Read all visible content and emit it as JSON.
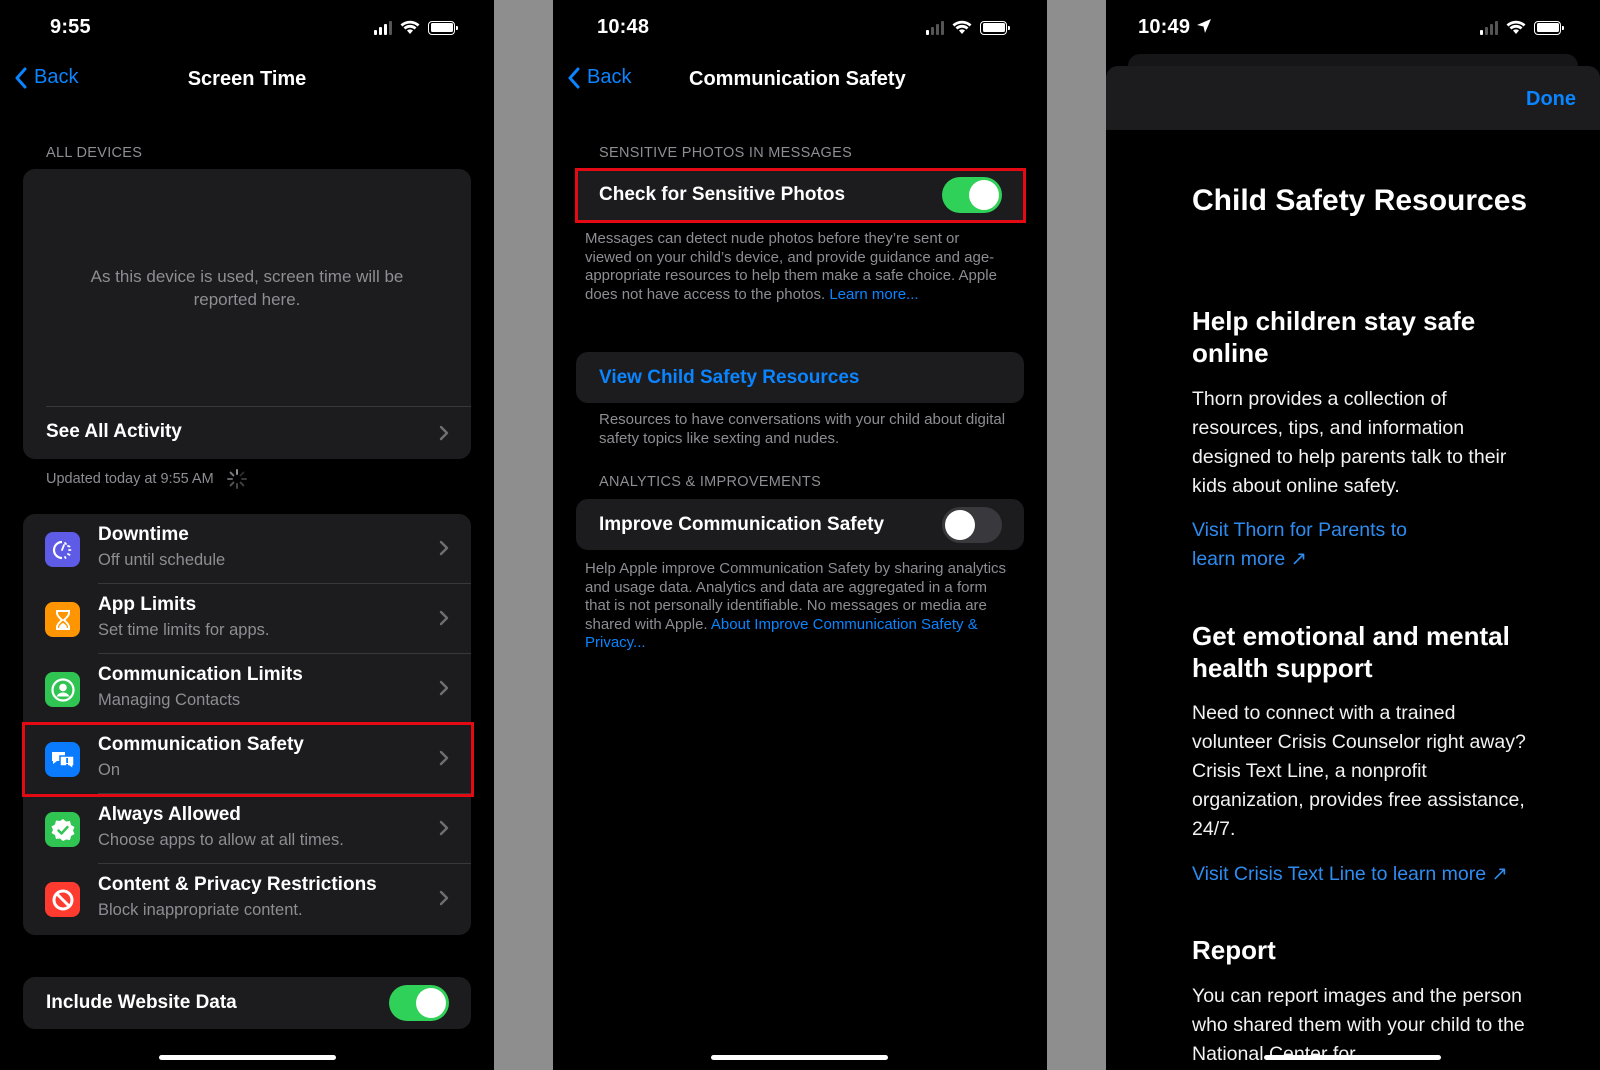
{
  "colors": {
    "accent": "#0a84ff",
    "toggle_on": "#30d158",
    "highlight": "#e50914",
    "cell_bg": "#1c1c1e"
  },
  "screen1": {
    "status": {
      "time": "9:55"
    },
    "nav": {
      "back_label": "Back",
      "title": "Screen Time"
    },
    "all_devices_header": "ALL DEVICES",
    "chart_placeholder": "As this device is used, screen time will be reported here.",
    "see_all_activity": "See All Activity",
    "updated_text": "Updated today at 9:55 AM",
    "items": [
      {
        "icon": "downtime-icon",
        "color": "#5e5ce6",
        "title": "Downtime",
        "subtitle": "Off until schedule"
      },
      {
        "icon": "hourglass-icon",
        "color": "#ff9500",
        "title": "App Limits",
        "subtitle": "Set time limits for apps."
      },
      {
        "icon": "contact-icon",
        "color": "#30c452",
        "title": "Communication Limits",
        "subtitle": "Managing Contacts"
      },
      {
        "icon": "chat-bubbles-icon",
        "color": "#0a7aff",
        "title": "Communication Safety",
        "subtitle": "On",
        "highlighted": true
      },
      {
        "icon": "checkmark-badge-icon",
        "color": "#30c452",
        "title": "Always Allowed",
        "subtitle": "Choose apps to allow at all times."
      },
      {
        "icon": "restricted-icon",
        "color": "#ff3b30",
        "title": "Content & Privacy Restrictions",
        "subtitle": "Block inappropriate content."
      }
    ],
    "include_website_data": {
      "label": "Include Website Data",
      "on": true
    }
  },
  "screen2": {
    "status": {
      "time": "10:48"
    },
    "nav": {
      "back_label": "Back",
      "title": "Communication Safety"
    },
    "sensitive_header": "SENSITIVE PHOTOS IN MESSAGES",
    "check_sensitive": {
      "label": "Check for Sensitive Photos",
      "on": true
    },
    "sensitive_footer": "Messages can detect nude photos before they’re sent or viewed on your child’s device, and provide guidance and age-appropriate resources to help them make a safe choice. Apple does not have access to the photos. ",
    "sensitive_footer_link": "Learn more...",
    "view_resources_label": "View Child Safety Resources",
    "resources_footer": "Resources to have conversations with your child about digital safety topics like sexting and nudes.",
    "analytics_header": "ANALYTICS & IMPROVEMENTS",
    "improve": {
      "label": "Improve Communication Safety",
      "on": false
    },
    "improve_footer": "Help Apple improve Communication Safety by sharing analytics and usage data. Analytics and data are aggregated in a form that is not personally identifiable. No messages or media are shared with Apple. ",
    "improve_footer_link": "About Improve Communication Safety & Privacy..."
  },
  "screen3": {
    "status": {
      "time": "10:49"
    },
    "done_label": "Done",
    "title": "Child Safety Resources",
    "sections": [
      {
        "heading": "Help children stay safe online",
        "body": "Thorn provides a collection of resources, tips, and information designed to help parents talk to their kids about online safety.",
        "link": "Visit Thorn for Parents to learn more ↗"
      },
      {
        "heading": "Get emotional and mental health support",
        "body": "Need to connect with a trained volunteer Crisis Counselor right away? Crisis Text Line, a nonprofit organization, provides free assistance, 24/7.",
        "link": "Visit Crisis Text Line to learn more ↗"
      },
      {
        "heading": "Report",
        "body": "You can report images and the person who shared them with your child to the National Center for"
      }
    ]
  }
}
